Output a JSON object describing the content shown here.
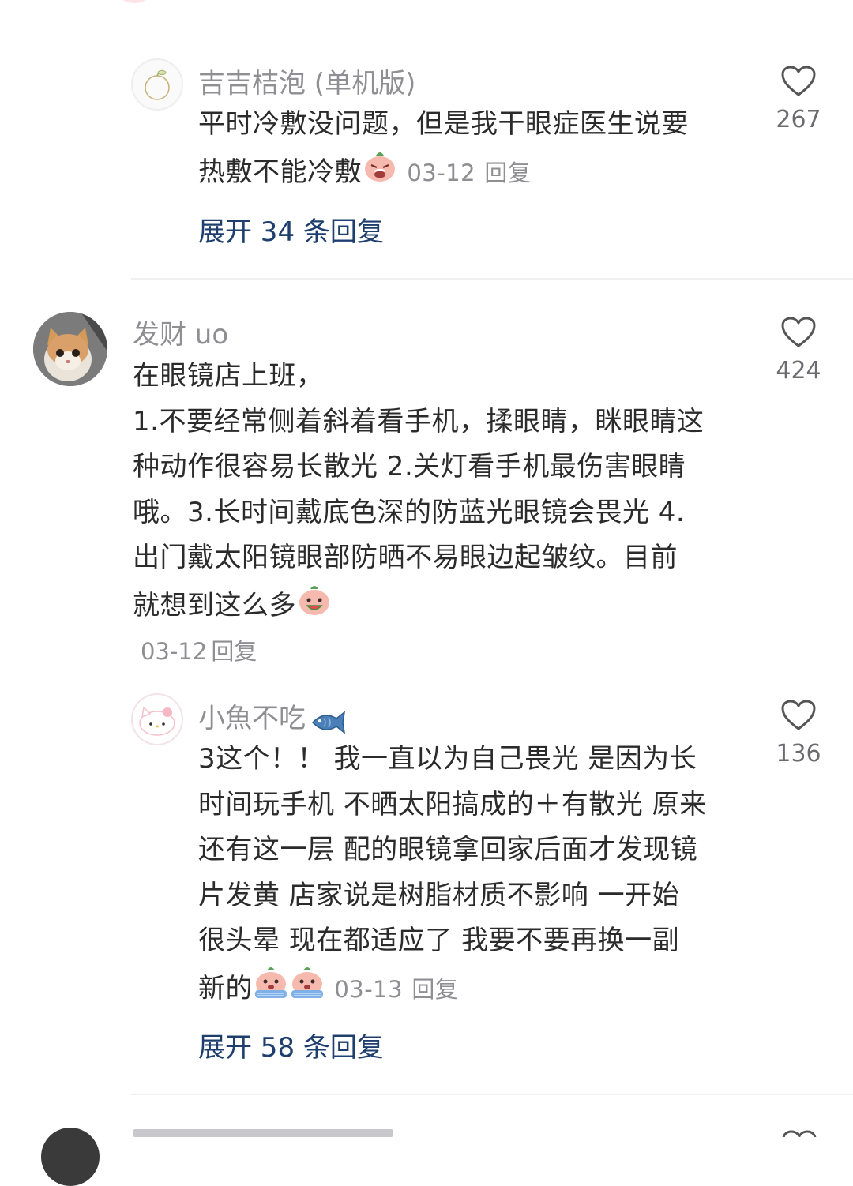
{
  "comments": [
    {
      "username": "吉吉桔泡 (单机版)",
      "text": [
        "平时冷敷没问题，但是我干眼症医生说要",
        "热敷不能冷敷"
      ],
      "date": "03-12",
      "reply_label": "回复",
      "likes": "267",
      "expand_label": "展开 34 条回复",
      "avatar_icon": "orange-icon"
    },
    {
      "username": "发财 uo",
      "text": [
        "在眼镜店上班，",
        "1.不要经常侧着斜着看手机，揉眼睛，眯眼睛这",
        "种动作很容易长散光 2.关灯看手机最伤害眼睛",
        "哦。3.长时间戴底色深的防蓝光眼镜会畏光 4.",
        "出门戴太阳镜眼部防晒不易眼边起皱纹。目前",
        "就想到这么多"
      ],
      "date": "03-12",
      "reply_label": "回复",
      "likes": "424",
      "avatar_icon": "cat-photo"
    },
    {
      "username": "小魚不吃",
      "text": [
        "3这个！！ 我一直以为自己畏光 是因为长",
        "时间玩手机 不晒太阳搞成的＋有散光 原来",
        "还有这一层 配的眼镜拿回家后面才发现镜",
        "片发黄 店家说是树脂材质不影响 一开始",
        "很头晕 现在都适应了 我要不要再换一副",
        "新的"
      ],
      "date": "03-13",
      "reply_label": "回复",
      "likes": "136",
      "expand_label": "展开 58 条回复",
      "avatar_icon": "hello-kitty-icon"
    }
  ],
  "colors": {
    "link": "#1e3f6e",
    "meta": "#8e8e93",
    "text": "#2b2b2b",
    "divider": "#f0f0f0"
  }
}
